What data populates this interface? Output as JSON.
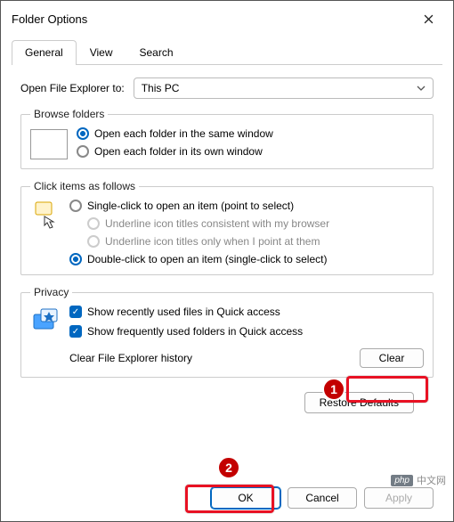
{
  "window": {
    "title": "Folder Options"
  },
  "tabs": {
    "general": "General",
    "view": "View",
    "search": "Search"
  },
  "open_to": {
    "label": "Open File Explorer to:",
    "value": "This PC"
  },
  "browse": {
    "legend": "Browse folders",
    "same": "Open each folder in the same window",
    "own": "Open each folder in its own window"
  },
  "click": {
    "legend": "Click items as follows",
    "single": "Single-click to open an item (point to select)",
    "underline_consistent": "Underline icon titles consistent with my browser",
    "underline_point": "Underline icon titles only when I point at them",
    "double": "Double-click to open an item (single-click to select)"
  },
  "privacy": {
    "legend": "Privacy",
    "recent": "Show recently used files in Quick access",
    "frequent": "Show frequently used folders in Quick access",
    "clear_label": "Clear File Explorer history",
    "clear_btn": "Clear"
  },
  "restore": "Restore Defaults",
  "buttons": {
    "ok": "OK",
    "cancel": "Cancel",
    "apply": "Apply"
  },
  "badges": {
    "b1": "1",
    "b2": "2"
  },
  "watermark": {
    "logo": "php",
    "text": "中文网"
  }
}
